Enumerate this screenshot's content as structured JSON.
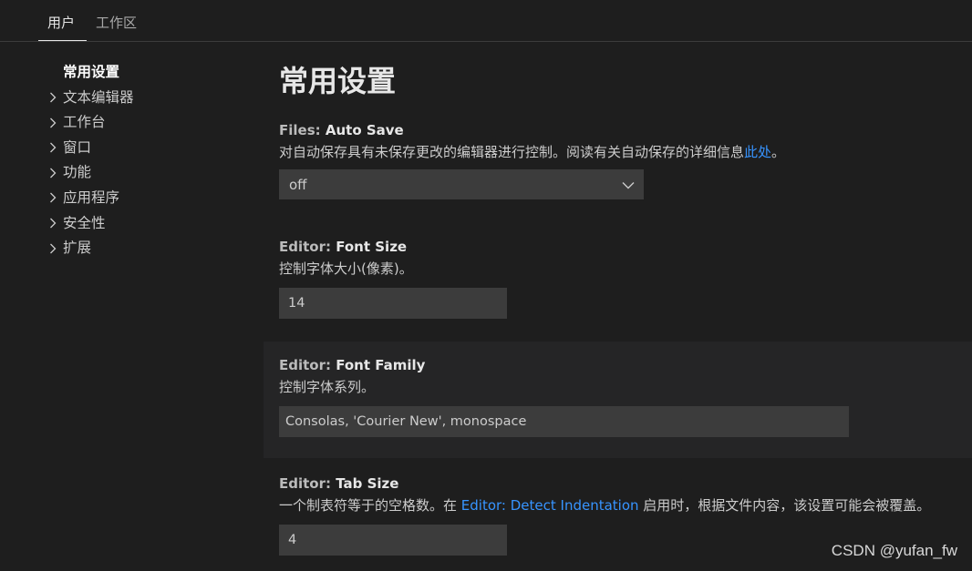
{
  "tabs": {
    "user": "用户",
    "workspace": "工作区"
  },
  "toc": {
    "selected": "常用设置",
    "items": [
      {
        "label": "文本编辑器"
      },
      {
        "label": "工作台"
      },
      {
        "label": "窗口"
      },
      {
        "label": "功能"
      },
      {
        "label": "应用程序"
      },
      {
        "label": "安全性"
      },
      {
        "label": "扩展"
      }
    ]
  },
  "page": {
    "title": "常用设置"
  },
  "settings": {
    "auto_save": {
      "category": "Files: ",
      "key": "Auto Save",
      "desc_prefix": "对自动保存具有未保存更改的编辑器进行控制。阅读有关自动保存的详细信息",
      "desc_link": "此处",
      "desc_suffix": "。",
      "value": "off"
    },
    "font_size": {
      "category": "Editor: ",
      "key": "Font Size",
      "desc": "控制字体大小(像素)。",
      "value": "14"
    },
    "font_family": {
      "category": "Editor: ",
      "key": "Font Family",
      "desc": "控制字体系列。",
      "value": "Consolas, 'Courier New', monospace"
    },
    "tab_size": {
      "category": "Editor: ",
      "key": "Tab Size",
      "desc_prefix": "一个制表符等于的空格数。在 ",
      "desc_link": "Editor: Detect Indentation",
      "desc_suffix": " 启用时，根据文件内容，该设置可能会被覆盖。",
      "value": "4"
    }
  },
  "watermark": "CSDN @yufan_fw",
  "colors": {
    "link": "#3794ff",
    "background": "#1e1e1e",
    "input_bg": "#3c3c3c"
  }
}
